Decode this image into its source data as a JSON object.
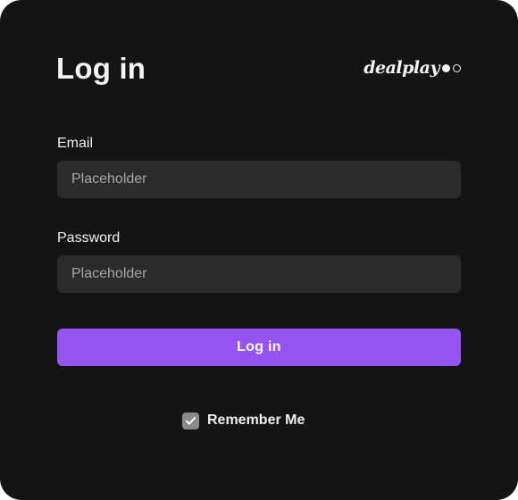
{
  "form": {
    "title": "Log in",
    "logo_text": "dealplay",
    "email_label": "Email",
    "email_placeholder": "Placeholder",
    "email_value": "",
    "password_label": "Password",
    "password_placeholder": "Placeholder",
    "password_value": "",
    "submit_label": "Log in",
    "remember_label": "Remember Me",
    "remember_checked": true
  },
  "icons": {
    "checkbox": "check-icon",
    "logo_dots": "logo-dots-icon"
  },
  "colors": {
    "card_background": "#141414",
    "field_background": "#2b2b2b",
    "accent": "#9553f2",
    "checkbox": "#8a8a8a",
    "text": "#f0f0f0",
    "placeholder": "#a6a6a6"
  }
}
